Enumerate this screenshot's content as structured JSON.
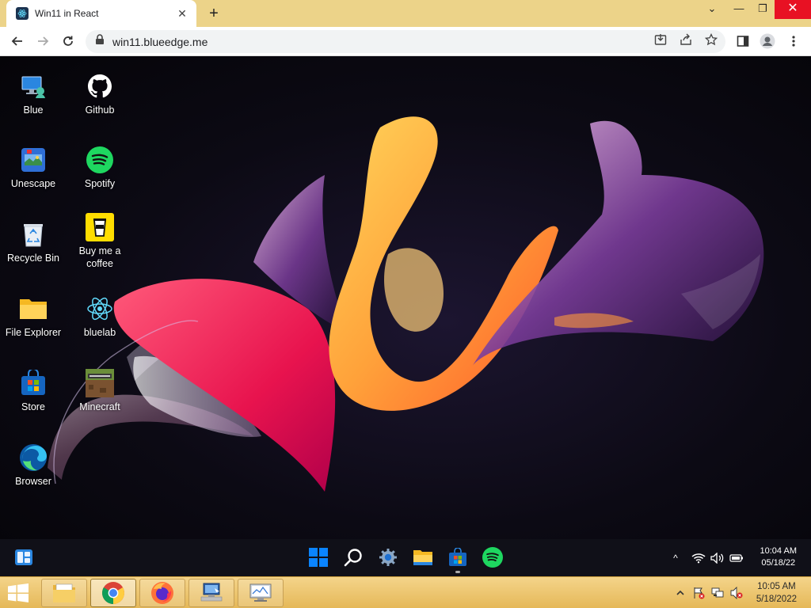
{
  "browser": {
    "tab_title": "Win11 in React",
    "tab_close": "✕",
    "new_tab": "+",
    "url": "win11.blueedge.me",
    "window_controls": {
      "minimize": "⌄",
      "restore": "❐",
      "close": "✕"
    }
  },
  "desktop": {
    "icons": [
      {
        "label": "Blue",
        "icon": "blue-pc-icon"
      },
      {
        "label": "Github",
        "icon": "github-icon"
      },
      {
        "label": "Unescape",
        "icon": "unescape-icon"
      },
      {
        "label": "Spotify",
        "icon": "spotify-icon"
      },
      {
        "label": "Recycle Bin",
        "icon": "recycle-bin-icon"
      },
      {
        "label": "Buy me a coffee",
        "icon": "coffee-icon"
      },
      {
        "label": "File Explorer",
        "icon": "folder-icon"
      },
      {
        "label": "bluelab",
        "icon": "react-icon"
      },
      {
        "label": "Store",
        "icon": "store-icon"
      },
      {
        "label": "Minecraft",
        "icon": "minecraft-icon"
      },
      {
        "label": "Browser",
        "icon": "edge-icon"
      }
    ]
  },
  "win11_taskbar": {
    "apps": [
      "windows-start-icon",
      "search-icon",
      "settings-icon",
      "file-explorer-icon",
      "store-icon",
      "spotify-icon"
    ],
    "tray_chevron": "^",
    "time": "10:04 AM",
    "date": "05/18/22"
  },
  "host_taskbar": {
    "buttons": [
      "file-manager-icon",
      "chrome-icon",
      "firefox-icon",
      "network-computer-icon",
      "monitor-icon"
    ],
    "time": "10:05 AM",
    "date": "5/18/2022"
  },
  "colors": {
    "host_taskbar": "#e9c06a",
    "tabstrip": "#ecd389",
    "win11_taskbar": "#101018"
  }
}
